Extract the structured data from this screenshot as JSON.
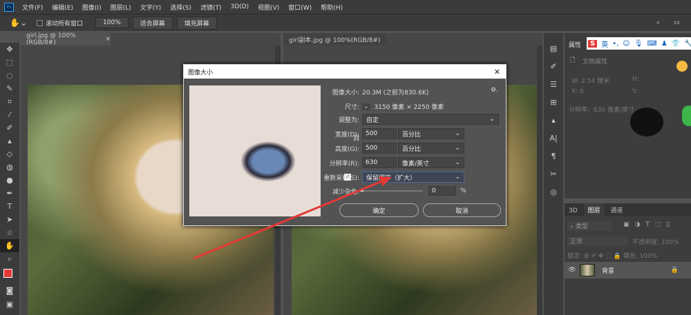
{
  "menu": {
    "logo": "Ps",
    "items": [
      "文件(F)",
      "编辑(E)",
      "图像(I)",
      "图层(L)",
      "文字(Y)",
      "选择(S)",
      "滤镜(T)",
      "3D(D)",
      "视图(V)",
      "窗口(W)",
      "帮助(H)"
    ]
  },
  "options": {
    "scroll_all": "滚动所有窗口",
    "zoom": "100%",
    "fit": "适合屏幕",
    "fill": "填充屏幕"
  },
  "docs": [
    {
      "tab": "girl.jpg @ 100%(RGB/8#)",
      "close": "×"
    },
    {
      "tab": "girl副本.jpg @ 100%(RGB/8#)"
    }
  ],
  "dialog": {
    "title": "图像大小",
    "close": "✕",
    "size_label": "图像大小:",
    "size_value": "20.3M (之前为830.6K)",
    "dim_label": "尺寸:",
    "dim_value": "3150 像素 × 2250 像素",
    "fit_label": "调整为:",
    "fit_value": "自定",
    "width_label": "宽度(D):",
    "width_value": "500",
    "width_unit": "百分比",
    "height_label": "高度(G):",
    "height_value": "500",
    "height_unit": "百分比",
    "res_label": "分辨率(R):",
    "res_value": "630",
    "res_unit": "像素/英寸",
    "resample_label": "重新采样(S):",
    "resample_value": "保留细节（扩大）",
    "noise_label": "减少杂色:",
    "noise_value": "0",
    "noise_unit": "%",
    "ok": "确定",
    "cancel": "取消"
  },
  "properties": {
    "title": "属性",
    "doc_props": "文档属性",
    "w": "W: 2.54 厘米",
    "h": "H:",
    "x": "X: 0",
    "y": "Y:",
    "res": "分辨率：630 像素/英寸"
  },
  "ime": {
    "logo": "S",
    "lang": "英"
  },
  "layers": {
    "tabs": [
      "3D",
      "图层",
      "通道"
    ],
    "filter": "类型",
    "blend": "正常",
    "opacity_label": "不透明度:",
    "opacity": "100%",
    "lock_label": "锁定:",
    "fill_label": "填充:",
    "fill": "100%",
    "layer_name": "背景"
  },
  "colors": {
    "fg": "#e53935",
    "arrow": "#e53935"
  }
}
